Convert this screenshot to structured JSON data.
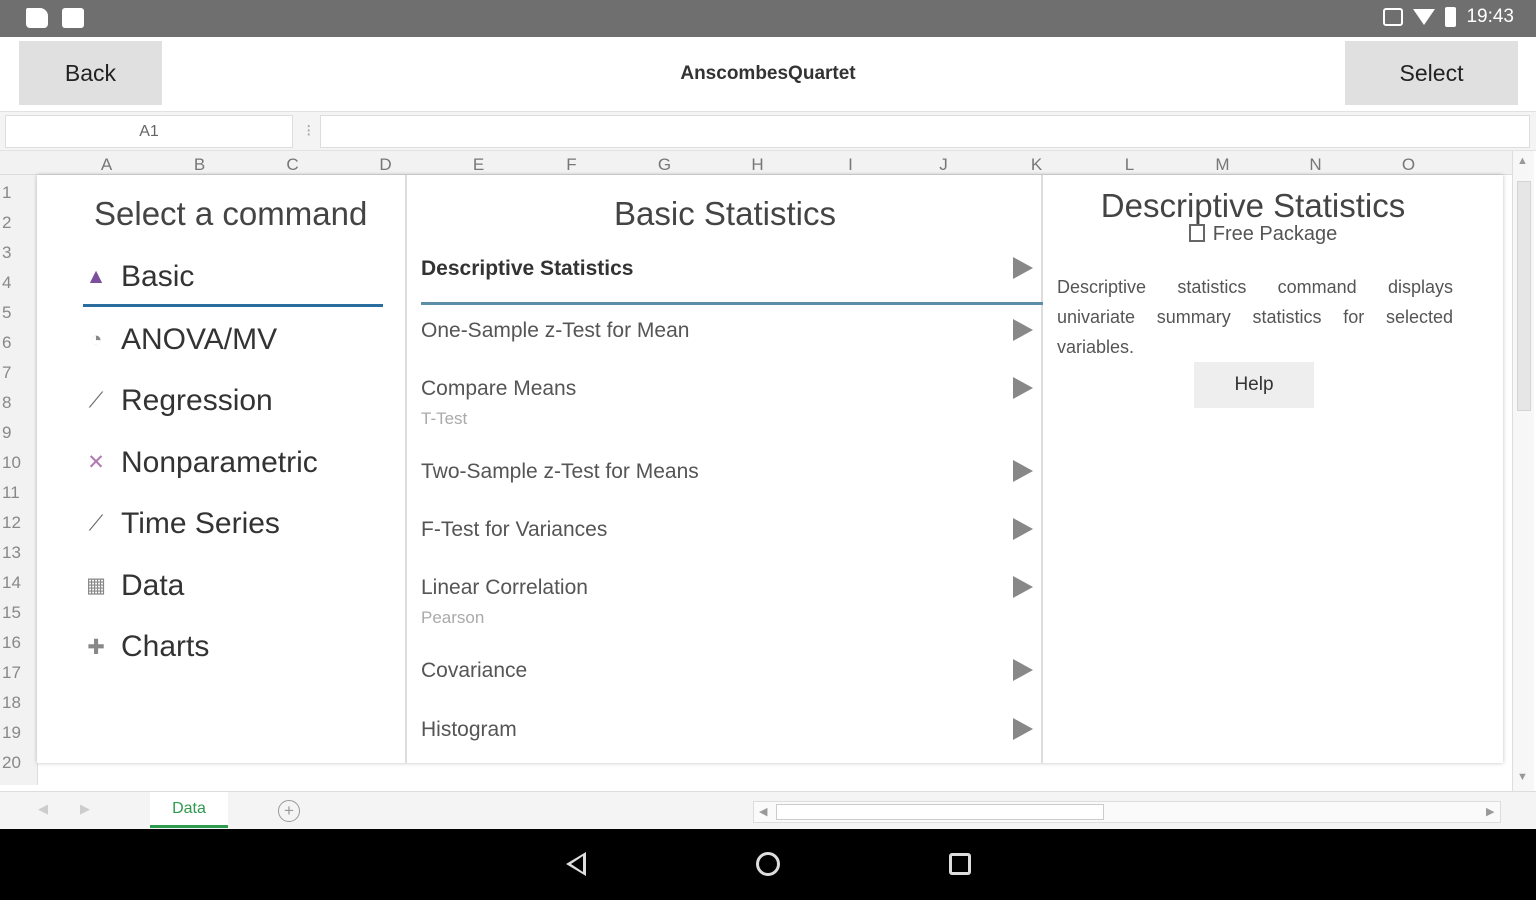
{
  "status_bar": {
    "time": "19:43",
    "icons": [
      "folder-icon",
      "image-icon",
      "mute-icon",
      "wifi-icon",
      "battery-icon"
    ]
  },
  "app_bar": {
    "back_label": "Back",
    "title": "AnscombesQuartet",
    "select_label": "Select"
  },
  "formula_bar": {
    "cell_ref": "A1",
    "separator": "⁝",
    "formula": ""
  },
  "grid": {
    "columns": [
      "A",
      "B",
      "C",
      "D",
      "E",
      "F",
      "G",
      "H",
      "I",
      "J",
      "K",
      "L",
      "M",
      "N",
      "O"
    ],
    "rows": [
      "1",
      "2",
      "3",
      "4",
      "5",
      "6",
      "7",
      "8",
      "9",
      "10",
      "11",
      "12",
      "13",
      "14",
      "15",
      "16",
      "17",
      "18",
      "19",
      "20"
    ]
  },
  "command_panel": {
    "categories_title": "Select a command",
    "categories": [
      {
        "label": "Basic",
        "icon": "basic-stats-icon",
        "glyph": "▲",
        "color": "#7a4f9c",
        "active": true
      },
      {
        "label": "ANOVA/MV",
        "icon": "anova-icon",
        "glyph": "◔",
        "color": "#888888",
        "active": false
      },
      {
        "label": "Regression",
        "icon": "regression-icon",
        "glyph": "⟋",
        "color": "#666666",
        "active": false
      },
      {
        "label": "Nonparametric",
        "icon": "nonparametric-icon",
        "glyph": "✕",
        "color": "#b07ab0",
        "active": false
      },
      {
        "label": "Time Series",
        "icon": "time-series-icon",
        "glyph": "⟋",
        "color": "#666666",
        "active": false
      },
      {
        "label": "Data",
        "icon": "data-table-icon",
        "glyph": "▦",
        "color": "#888888",
        "active": false
      },
      {
        "label": "Charts",
        "icon": "charts-icon",
        "glyph": "✚",
        "color": "#888888",
        "active": false
      }
    ],
    "commands_title": "Basic Statistics",
    "commands": [
      {
        "name": "Descriptive Statistics",
        "sub": "",
        "active": true
      },
      {
        "name": "One-Sample z-Test for Mean",
        "sub": "",
        "active": false
      },
      {
        "name": "Compare Means",
        "sub": "T-Test",
        "active": false
      },
      {
        "name": "Two-Sample z-Test for Means",
        "sub": "",
        "active": false
      },
      {
        "name": "F-Test for Variances",
        "sub": "",
        "active": false
      },
      {
        "name": "Linear Correlation",
        "sub": "Pearson",
        "active": false
      },
      {
        "name": "Covariance",
        "sub": "",
        "active": false
      },
      {
        "name": "Histogram",
        "sub": "",
        "active": false
      }
    ],
    "detail": {
      "title": "Descriptive Statistics",
      "package": "Free Package",
      "description": "Descriptive statistics command displays univariate summary statistics for selected variables.",
      "help_label": "Help"
    }
  },
  "sheet_bar": {
    "tab_label": "Data",
    "add_label": "+"
  }
}
